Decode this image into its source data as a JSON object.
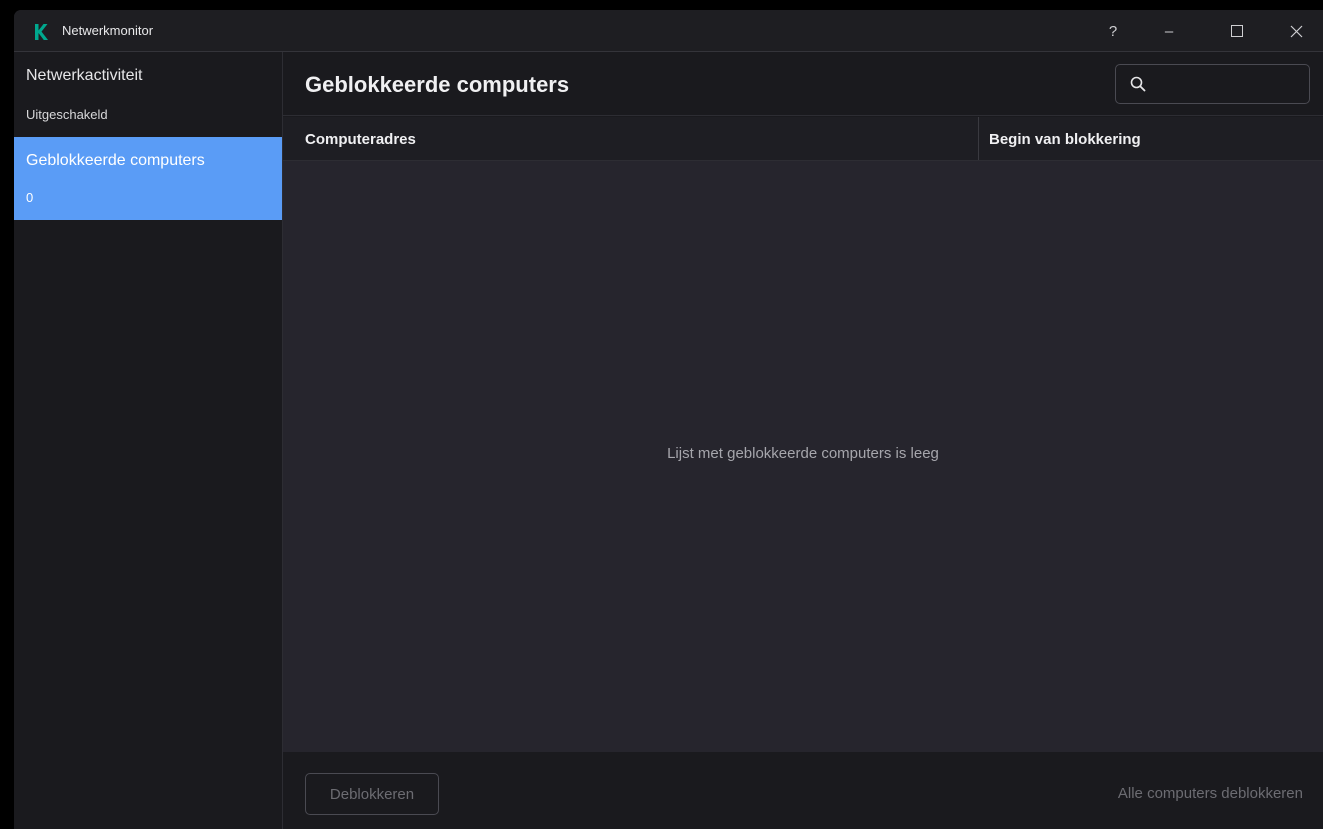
{
  "window": {
    "title": "Netwerkmonitor",
    "help_label": "?",
    "minimize_label": "–",
    "maximize_label": "☐",
    "close_label": "✕",
    "logo_icon": "kaspersky-k-icon",
    "accent": "#00a88e"
  },
  "sidebar": {
    "items": [
      {
        "label": "Netwerkactiviteit",
        "sub": "Uitgeschakeld"
      },
      {
        "label": "Geblokkeerde computers",
        "sub": "0"
      }
    ],
    "selected_color": "#5a9cf6"
  },
  "main": {
    "title": "Geblokkeerde computers",
    "search": {
      "placeholder": "",
      "value": "",
      "icon": "search-icon"
    },
    "table": {
      "columns": [
        "Computeradres",
        "Begin van blokkering"
      ],
      "rows": [],
      "empty_message": "Lijst met geblokkeerde computers is leeg"
    },
    "footer": {
      "unblock_label": "Deblokkeren",
      "unblock_all_label": "Alle computers deblokkeren"
    }
  }
}
